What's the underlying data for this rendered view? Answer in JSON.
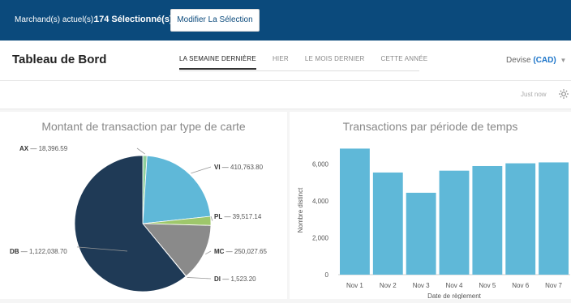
{
  "topbar": {
    "merchant_label": "Marchand(s) actuel(s):",
    "merchant_count": "174 Sélectionné(s)",
    "modify_button": "Modifier La Sélection"
  },
  "header": {
    "title": "Tableau de Bord",
    "tabs": [
      {
        "label": "LA SEMAINE DERNIÈRE",
        "active": true
      },
      {
        "label": "HIER",
        "active": false
      },
      {
        "label": "LE MOIS DERNIER",
        "active": false
      },
      {
        "label": "CETTE ANNÉE",
        "active": false
      }
    ],
    "currency_label": "Devise",
    "currency_code": "(CAD)"
  },
  "subbar": {
    "updated": "Just now",
    "settings_icon": "gear-icon"
  },
  "colors": {
    "topbar": "#0b4a7c",
    "bar": "#5fb8d8",
    "pie_vi": "#5fb8d8",
    "pie_pl": "#9ec76b",
    "pie_mc": "#8a8a8a",
    "pie_di": "#cfcfcf",
    "pie_db": "#1f3a56",
    "pie_ax": "#8fcf9c"
  },
  "chart_data": [
    {
      "type": "pie",
      "title": "Montant de transaction par type de carte",
      "slices": [
        {
          "label": "AX",
          "value": 18396.59,
          "text": "18,396.59"
        },
        {
          "label": "VI",
          "value": 410763.8,
          "text": "410,763.80"
        },
        {
          "label": "PL",
          "value": 39517.14,
          "text": "39,517.14"
        },
        {
          "label": "MC",
          "value": 250027.65,
          "text": "250,027.65"
        },
        {
          "label": "DI",
          "value": 1523.2,
          "text": "1,523.20"
        },
        {
          "label": "DB",
          "value": 1122038.7,
          "text": "1,122,038.70"
        }
      ]
    },
    {
      "type": "bar",
      "title": "Transactions par période de temps",
      "categories": [
        "Nov 1",
        "Nov 2",
        "Nov 3",
        "Nov 4",
        "Nov 5",
        "Nov 6",
        "Nov 7"
      ],
      "values": [
        6850,
        5550,
        4450,
        5650,
        5900,
        6050,
        6100
      ],
      "xlabel": "Date de règlement",
      "ylabel": "Nombre distinct",
      "ylim": [
        0,
        7000
      ],
      "yticks": [
        "0",
        "2,000",
        "4,000",
        "6,000"
      ],
      "grid": false
    }
  ]
}
